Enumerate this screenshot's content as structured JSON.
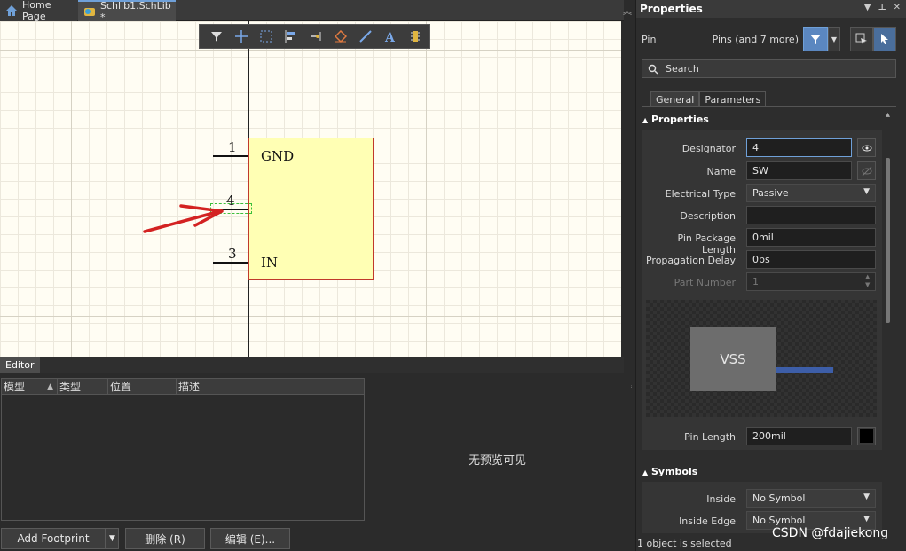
{
  "tabs": [
    {
      "label": "Home Page"
    },
    {
      "label": "Schlib1.SchLib *"
    }
  ],
  "component": {
    "pins": [
      {
        "number": "1",
        "name": "GND"
      },
      {
        "number": "4",
        "name": ""
      },
      {
        "number": "3",
        "name": "IN"
      }
    ],
    "body_color": "#ffffb4",
    "body_border": "#c0392b"
  },
  "editor": {
    "tab_label": "Editor",
    "columns": [
      "模型",
      "类型",
      "位置",
      "描述"
    ],
    "preview_text": "无预览可见",
    "buttons": {
      "add_footprint": "Add Footprint",
      "delete": "删除 (R)",
      "edit": "编辑 (E)..."
    }
  },
  "properties": {
    "title": "Properties",
    "object_kind": "Pin",
    "filter_text": "Pins (and 7 more)",
    "search_placeholder": "Search",
    "tabs": [
      "General",
      "Parameters"
    ],
    "section_properties": "Properties",
    "fields": {
      "designator_label": "Designator",
      "designator_value": "4",
      "name_label": "Name",
      "name_value": "SW",
      "electrical_type_label": "Electrical Type",
      "electrical_type_value": "Passive",
      "description_label": "Description",
      "description_value": "",
      "pin_package_length_label": "Pin Package Length",
      "pin_package_length_value": "0mil",
      "propagation_delay_label": "Propagation Delay",
      "propagation_delay_value": "0ps",
      "part_number_label": "Part Number",
      "part_number_value": "1",
      "pin_length_label": "Pin Length",
      "pin_length_value": "200mil"
    },
    "preview_label": "VSS",
    "section_symbols": "Symbols",
    "symbols": {
      "inside_label": "Inside",
      "inside_value": "No Symbol",
      "inside_edge_label": "Inside Edge",
      "inside_edge_value": "No Symbol"
    },
    "status": "1 object is selected"
  },
  "watermark": "CSDN @fdajiekong",
  "colors": {
    "accent": "#6fa0d8",
    "filter_button": "#5b87c0",
    "pin_preview_body": "#6d6d6d",
    "pin_preview_line": "#3d5ea8",
    "annotation_arrow": "#d32222"
  }
}
